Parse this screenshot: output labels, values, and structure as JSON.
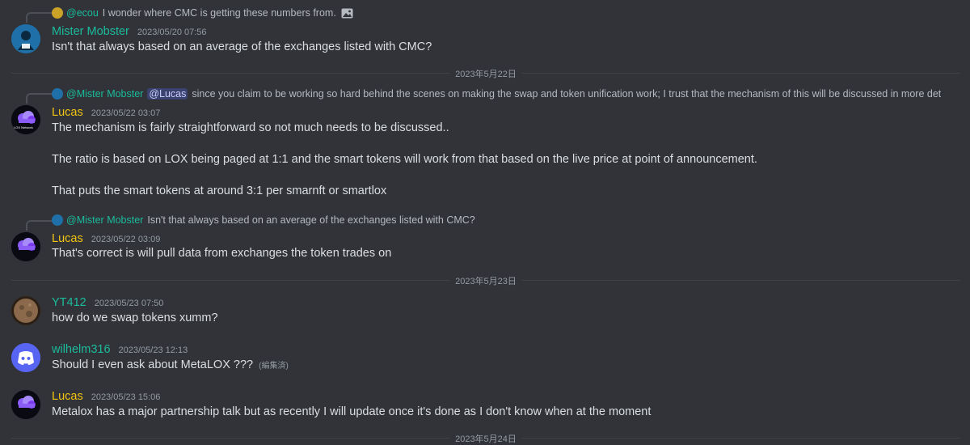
{
  "colors": {
    "teal": "#1abc9c",
    "gold": "#f1c40f",
    "background": "#313338",
    "discord_blurple": "#5865f2"
  },
  "messages": [
    {
      "reply": {
        "name": "@ecou",
        "text": "I wonder where CMC is getting these numbers from.",
        "icon": "image-icon"
      },
      "author": "Mister Mobster",
      "time": "2023/05/20 07:56",
      "text": "Isn't that always based on an average of the exchanges listed with CMC?"
    },
    {
      "reply": {
        "name": "@Mister Mobster",
        "mention": "@Lucas",
        "text": "since you claim to be working so hard behind the scenes on making the swap and token unification work; I trust that the mechanism of this will be discussed in more detail with the"
      },
      "author": "Lucas",
      "time": "2023/05/22 03:07",
      "lines": [
        "The mechanism is fairly straightforward so not much needs to be discussed..",
        "The ratio is based on LOX being paged at 1:1 and the smart tokens will work from that based on the live price at point of announcement.",
        "That puts the smart tokens at around 3:1 per smarnft or smartlox"
      ]
    },
    {
      "reply": {
        "name": "@Mister Mobster",
        "text": "Isn't that always based on an average of the exchanges listed with CMC?"
      },
      "author": "Lucas",
      "time": "2023/05/22 03:09",
      "text": "That's correct is will pull data from exchanges the token trades on"
    },
    {
      "author": "YT412",
      "time": "2023/05/23 07:50",
      "text": "how do we swap tokens xumm?"
    },
    {
      "author": "wilhelm316",
      "time": "2023/05/23 12:13",
      "text": "Should I even ask about MetaLOX ???",
      "edited": "(編集済)"
    },
    {
      "author": "Lucas",
      "time": "2023/05/23 15:06",
      "text": "Metalox has a major partnership talk but as recently I will update once it's done as I don't know when at the moment"
    }
  ],
  "dividers": [
    "2023年5月22日",
    "2023年5月23日",
    "2023年5月24日"
  ],
  "avatar_label": "LOX Network"
}
